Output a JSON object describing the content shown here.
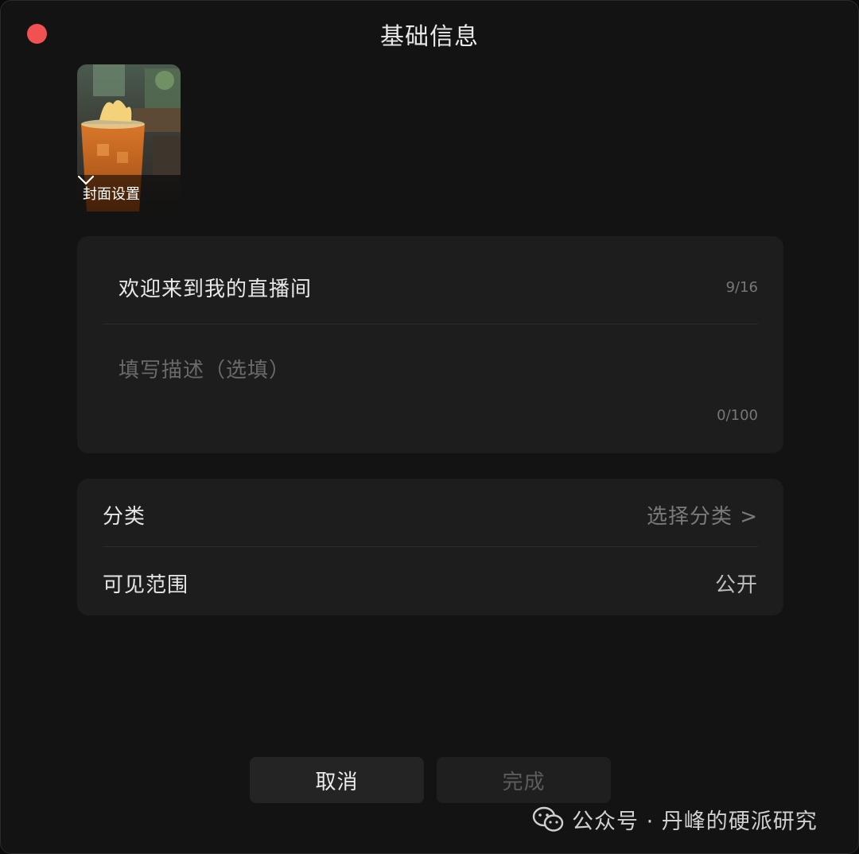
{
  "window": {
    "title": "基础信息"
  },
  "cover": {
    "label": "封面设置"
  },
  "info": {
    "title_value": "欢迎来到我的直播间",
    "title_count": "9/16",
    "description_placeholder": "填写描述（选填）",
    "description_count": "0/100"
  },
  "settings": {
    "category_label": "分类",
    "category_value": "选择分类 >",
    "visibility_label": "可见范围",
    "visibility_value": "公开"
  },
  "actions": {
    "cancel_label": "取消",
    "done_label": "完成"
  },
  "watermark": {
    "text": "公众号 · 丹峰的硬派研究"
  },
  "colors": {
    "close_dot": "#f25151",
    "background": "#131313",
    "card": "#1d1d1d"
  }
}
